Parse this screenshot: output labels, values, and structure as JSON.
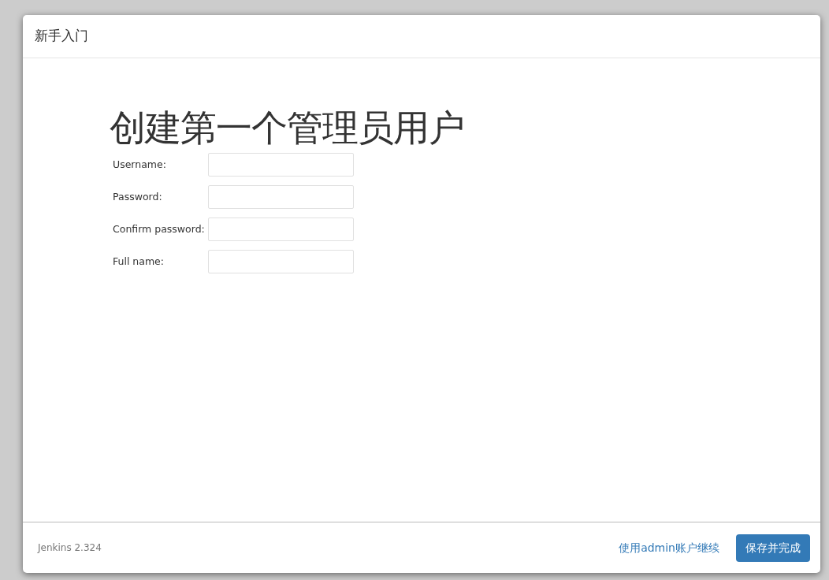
{
  "dialog": {
    "title": "新手入门"
  },
  "heading": "创建第一个管理员用户",
  "fields": [
    {
      "label": "Username:"
    },
    {
      "label": "Password:"
    },
    {
      "label": "Confirm password:"
    },
    {
      "label": "Full name:"
    }
  ],
  "footer": {
    "version": "Jenkins 2.324",
    "link": "使用admin账户继续",
    "button": "保存并完成"
  }
}
